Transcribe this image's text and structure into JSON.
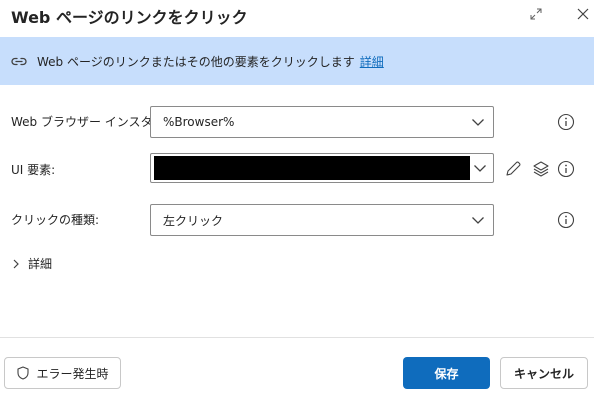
{
  "dialog": {
    "title": "Web ページのリンクをクリック"
  },
  "banner": {
    "text": "Web ページのリンクまたはその他の要素をクリックします",
    "link": "詳細"
  },
  "fields": {
    "browser": {
      "label": "Web ブラウザー インスタンス:",
      "value": "%Browser%"
    },
    "ui_element": {
      "label": "UI 要素:"
    },
    "click_type": {
      "label": "クリックの種類:",
      "value": "左クリック"
    }
  },
  "details": {
    "label": "詳細"
  },
  "footer": {
    "error_button": "エラー発生時",
    "save_button": "保存",
    "cancel_button": "キャンセル"
  },
  "colors": {
    "banner_bg": "#c7defc",
    "primary": "#0f6cbd",
    "link": "#0f6cbd"
  }
}
